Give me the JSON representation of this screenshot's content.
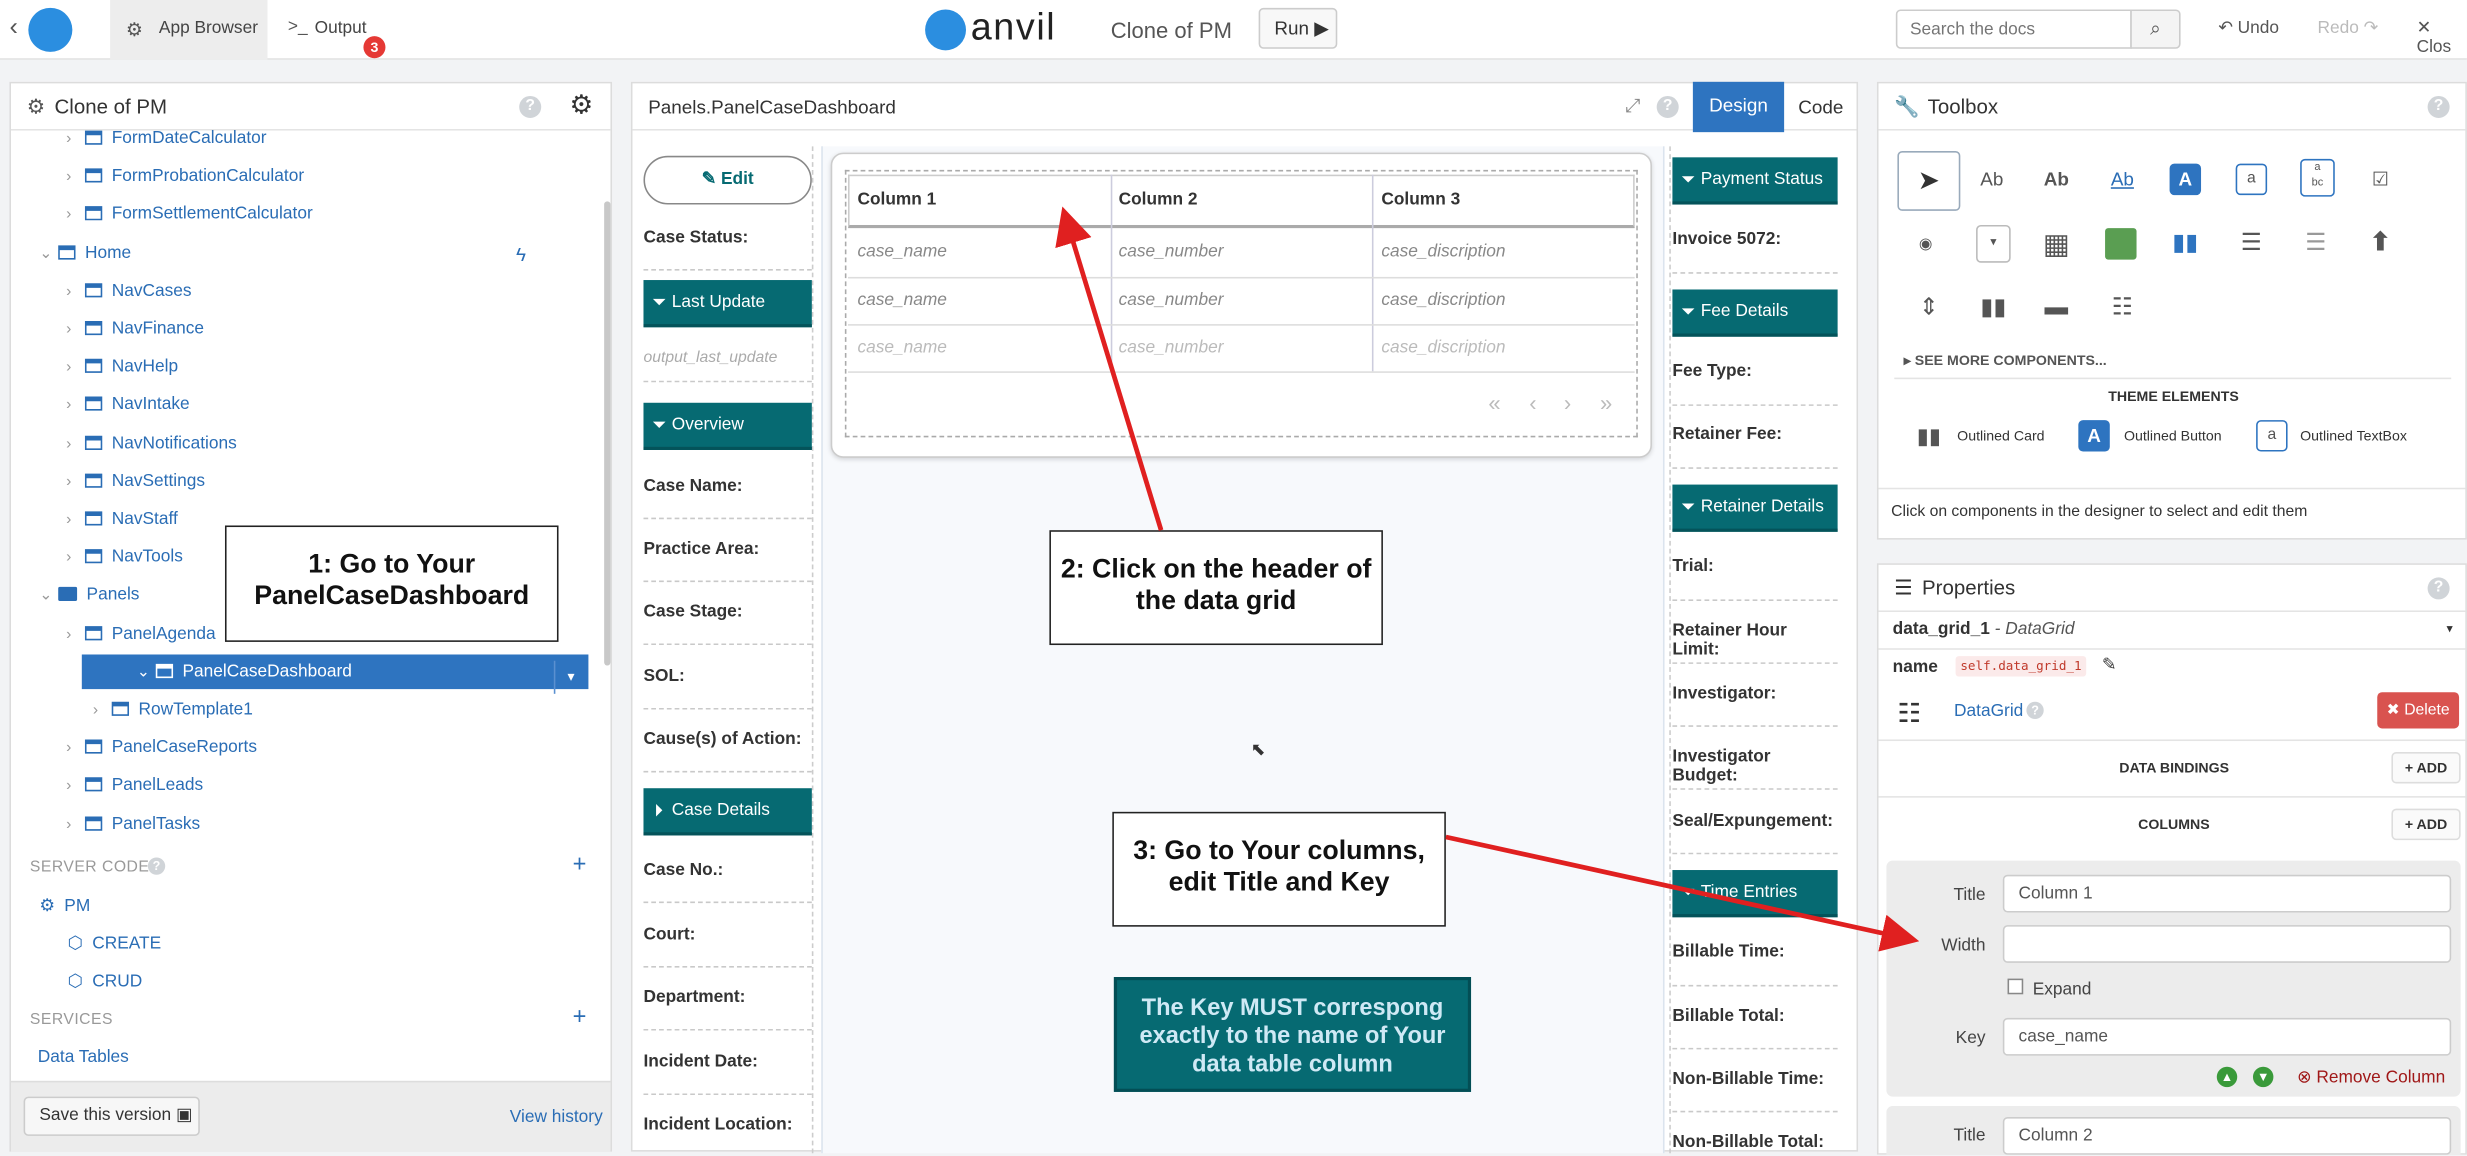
{
  "topbar": {
    "app_browser": "App Browser",
    "output": "Output",
    "output_badge": "3",
    "brand": "anvil",
    "app_name": "Clone of PM",
    "run": "Run",
    "search_placeholder": "Search the docs",
    "undo": "Undo",
    "redo": "Redo",
    "close": "Clos"
  },
  "app_panel": {
    "title": "Clone of PM",
    "tree": [
      {
        "label": "FormDateCalculator",
        "depth": 2,
        "type": "form"
      },
      {
        "label": "FormProbationCalculator",
        "depth": 2,
        "type": "form"
      },
      {
        "label": "FormSettlementCalculator",
        "depth": 2,
        "type": "form"
      },
      {
        "label": "Home",
        "depth": 1,
        "type": "form",
        "expanded": true
      },
      {
        "label": "NavCases",
        "depth": 2,
        "type": "form"
      },
      {
        "label": "NavFinance",
        "depth": 2,
        "type": "form"
      },
      {
        "label": "NavHelp",
        "depth": 2,
        "type": "form"
      },
      {
        "label": "NavIntake",
        "depth": 2,
        "type": "form"
      },
      {
        "label": "NavNotifications",
        "depth": 2,
        "type": "form"
      },
      {
        "label": "NavSettings",
        "depth": 2,
        "type": "form"
      },
      {
        "label": "NavStaff",
        "depth": 2,
        "type": "form"
      },
      {
        "label": "NavTools",
        "depth": 2,
        "type": "form"
      },
      {
        "label": "Panels",
        "depth": 1,
        "type": "folder",
        "expanded": true
      },
      {
        "label": "PanelAgenda",
        "depth": 2,
        "type": "form"
      },
      {
        "label": "PanelCaseDashboard",
        "depth": 2,
        "type": "form",
        "selected": true,
        "expanded": true
      },
      {
        "label": "RowTemplate1",
        "depth": 3,
        "type": "form"
      },
      {
        "label": "PanelCaseReports",
        "depth": 2,
        "type": "form"
      },
      {
        "label": "PanelLeads",
        "depth": 2,
        "type": "form"
      },
      {
        "label": "PanelTasks",
        "depth": 2,
        "type": "form"
      }
    ],
    "server_code_label": "SERVER CODE",
    "server_items": [
      "PM",
      "CREATE",
      "CRUD"
    ],
    "services_label": "SERVICES",
    "services_items": [
      "Data Tables"
    ],
    "save_version": "Save this version",
    "view_history": "View history"
  },
  "designer": {
    "title": "Panels.PanelCaseDashboard",
    "design_tab": "Design",
    "code_tab": "Code",
    "edit": "Edit",
    "left_labels": [
      "Case Status:",
      "Case Name:",
      "Practice Area:",
      "Case Stage:",
      "SOL:",
      "Cause(s) of Action:",
      "Case No.:",
      "Court:",
      "Department:",
      "Incident Date:",
      "Incident Location:"
    ],
    "left_sections": [
      "Last Update",
      "Overview",
      "Case Details"
    ],
    "output_last_update": "output_last_update",
    "grid": {
      "columns": [
        "Column 1",
        "Column 2",
        "Column 3"
      ],
      "rows": [
        [
          "case_name",
          "case_number",
          "case_discription"
        ],
        [
          "case_name",
          "case_number",
          "case_discription"
        ],
        [
          "case_name",
          "case_number",
          "case_discription"
        ]
      ]
    },
    "right_sections": [
      "Payment Status",
      "Fee Details",
      "Retainer Details",
      "Time Entries"
    ],
    "right_labels": [
      "Invoice 5072:",
      "Fee Type:",
      "Retainer Fee:",
      "Trial:",
      "Retainer Hour Limit:",
      "Investigator:",
      "Investigator Budget:",
      "Seal/Expungement:",
      "Billable Time:",
      "Billable Total:",
      "Non-Billable Time:",
      "Non-Billable Total:"
    ]
  },
  "annotations": {
    "step1": "1: Go to Your PanelCaseDashboard",
    "step2": "2: Click on the header of the data grid",
    "step3": "3: Go to Your columns, edit Title and Key",
    "note": "The Key MUST correspong exactly to the name of Your data table column"
  },
  "toolbox": {
    "title": "Toolbox",
    "see_more": "SEE MORE COMPONENTS...",
    "theme_elements": "THEME ELEMENTS",
    "theme_items": [
      "Outlined Card",
      "Outlined Button",
      "Outlined TextBox"
    ],
    "hint": "Click on components in the designer to select and edit them"
  },
  "properties": {
    "title": "Properties",
    "component": "data_grid_1",
    "component_type": "- DataGrid",
    "name_label": "name",
    "name_value": "self.data_grid_1",
    "type_label": "DataGrid",
    "delete": "Delete",
    "data_bindings": "DATA BINDINGS",
    "columns_label": "COLUMNS",
    "add": "ADD",
    "title_label": "Title",
    "width_label": "Width",
    "expand_label": "Expand",
    "key_label": "Key",
    "col1_title": "Column 1",
    "col1_key": "case_name",
    "remove_column": "Remove Column",
    "col2_title": "Column 2"
  },
  "colors": {
    "teal": "#066a72",
    "accent": "#2e74c0",
    "delete": "#d9534f",
    "annotation_arrow": "#e02020"
  }
}
